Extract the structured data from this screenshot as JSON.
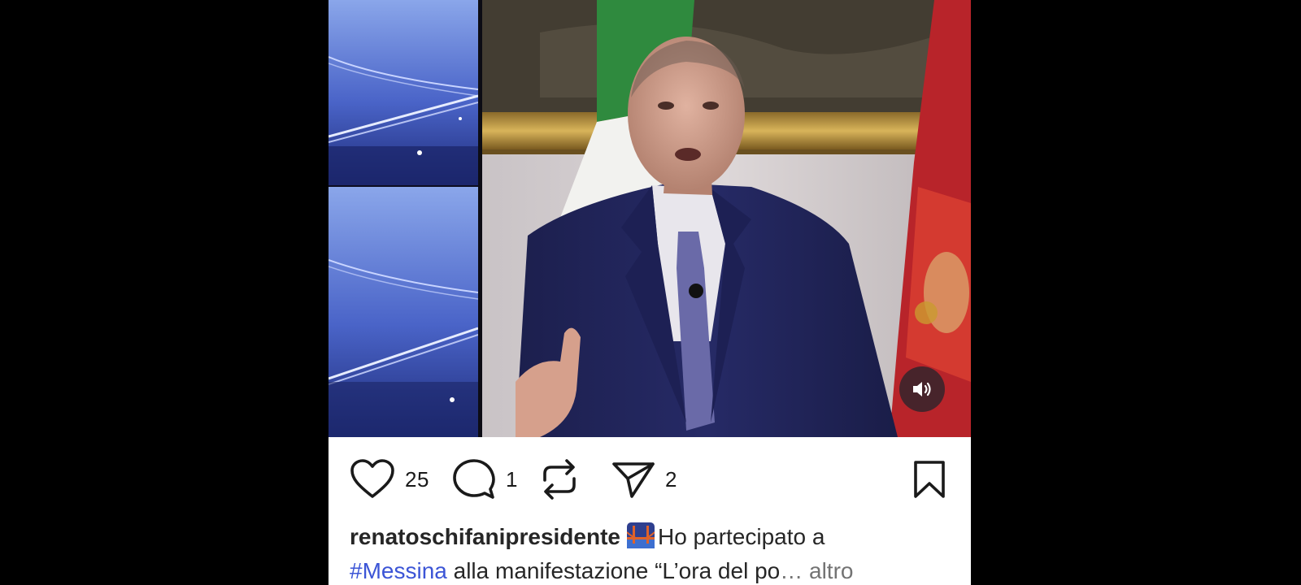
{
  "post": {
    "media": {
      "type": "video",
      "mute_icon": "speaker-icon"
    },
    "actions": {
      "like_icon": "heart-icon",
      "like_count": "25",
      "comment_icon": "speech-bubble-icon",
      "comment_count": "1",
      "repost_icon": "repost-arrows-icon",
      "share_icon": "paper-plane-icon",
      "share_count": "2",
      "save_icon": "bookmark-icon"
    },
    "caption": {
      "username": "renatoschifanipresidente",
      "emoji": "bridge-at-night-emoji",
      "line1_text": "Ho partecipato a",
      "hashtag": "#Messina",
      "line2_text": "alla manifestazione “L’ora del po",
      "ellipsis": "…",
      "more_label": "altro"
    }
  },
  "colors": {
    "background": "#000000",
    "post_background": "#ffffff",
    "hashtag": "#3c55d6",
    "muted_text": "#737373",
    "text": "#262626"
  }
}
